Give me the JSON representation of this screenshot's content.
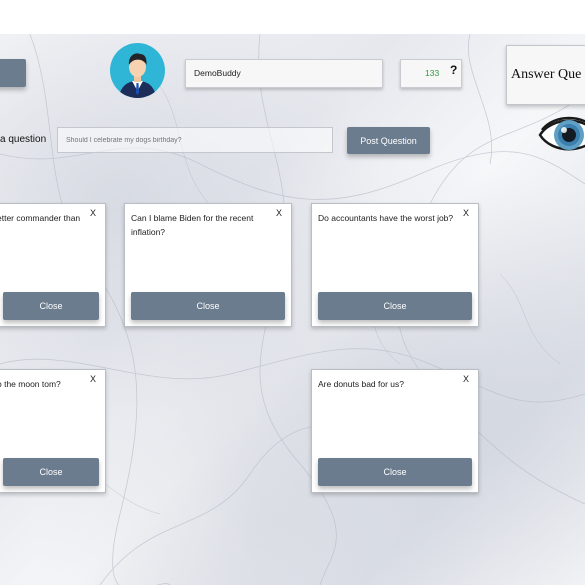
{
  "header": {
    "username": "DemoBuddy",
    "score": "133",
    "help_label": "?",
    "answer_button_label": "Answer Que"
  },
  "ask": {
    "label": "a question",
    "placeholder": "Should I celebrate my dogs birthday?",
    "post_button_label": "Post Question"
  },
  "cards": [
    {
      "question": "etter commander than",
      "close_label": "Close",
      "x_label": "X"
    },
    {
      "question": "Can I blame Biden for the recent inflation?",
      "close_label": "Close",
      "x_label": "X"
    },
    {
      "question": "Do accountants have the worst job?",
      "close_label": "Close",
      "x_label": "X"
    },
    {
      "question": "o the moon tom?",
      "close_label": "Close",
      "x_label": "X"
    },
    {
      "question": "Are donuts bad for us?",
      "close_label": "Close",
      "x_label": "X"
    }
  ],
  "colors": {
    "button": "#6b7c8f",
    "score_green": "#2e9a3c",
    "avatar_bg": "#2fb6d6"
  },
  "icons": [
    "avatar",
    "eye-icon"
  ]
}
